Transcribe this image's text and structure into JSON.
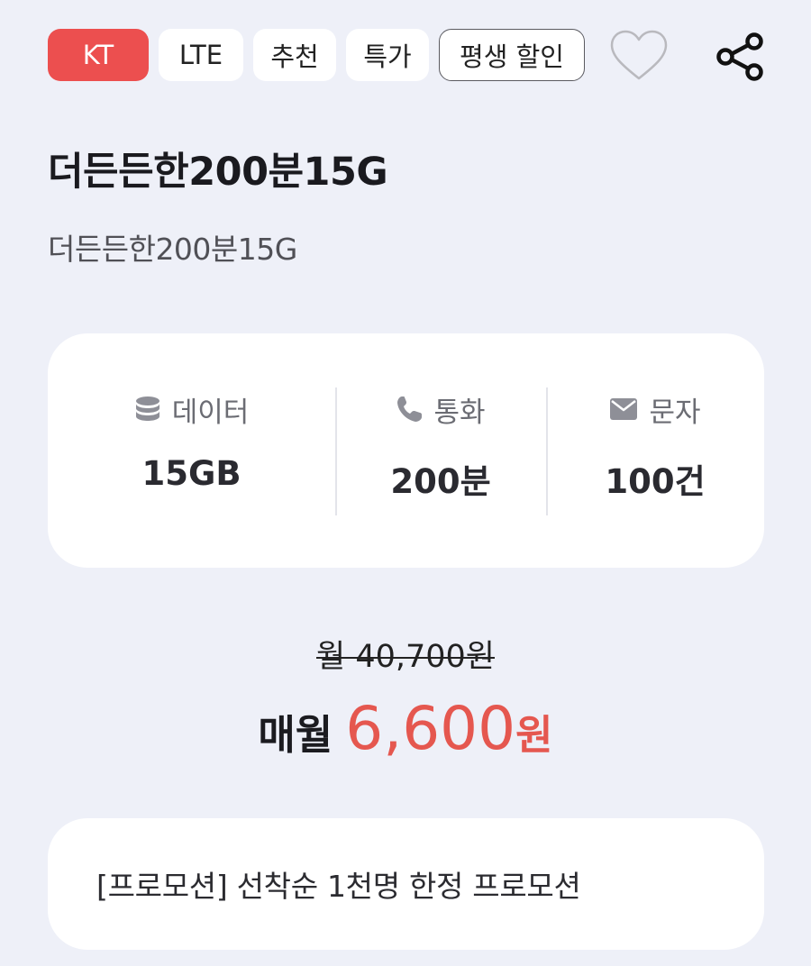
{
  "tags": {
    "carrier": "KT",
    "network": "LTE",
    "recommended": "추천",
    "special": "특가",
    "lifetime_discount": "평생 할인"
  },
  "actions": {
    "favorite_icon": "heart-outline-icon",
    "share_icon": "share-icon"
  },
  "plan": {
    "title": "더든든한200분15G",
    "subtitle": "더든든한200분15G"
  },
  "specs": {
    "data": {
      "icon": "database-icon",
      "label": "데이터",
      "value": "15GB"
    },
    "call": {
      "icon": "phone-icon",
      "label": "통화",
      "value": "200분"
    },
    "sms": {
      "icon": "envelope-icon",
      "label": "문자",
      "value": "100건"
    }
  },
  "price": {
    "original": "월 40,700원",
    "prefix": "매월",
    "amount": "6,600",
    "unit": "원"
  },
  "promotion": {
    "text": "[프로모션] 선착순 1천명 한정 프로모션"
  },
  "colors": {
    "background": "#eef0f8",
    "carrier_badge": "#ec4f4f",
    "price_accent": "#e5574f",
    "card": "#ffffff"
  }
}
